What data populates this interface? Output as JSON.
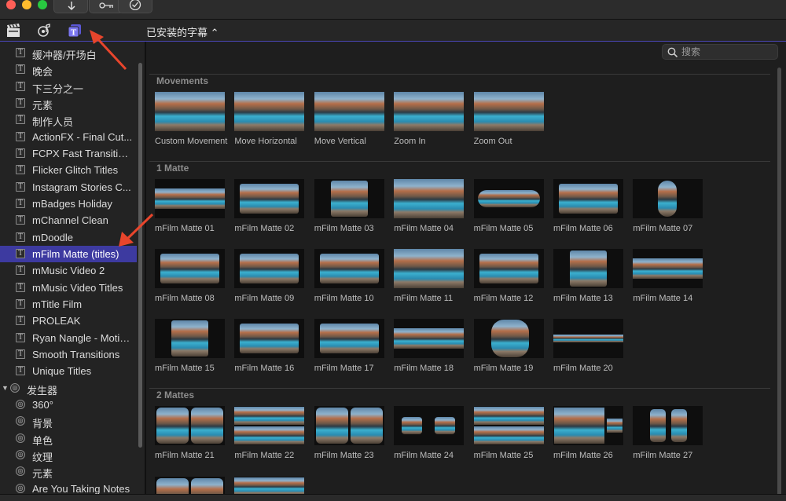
{
  "toolbar": {
    "import_icon": "down-arrow-icon",
    "keyword_icon": "key-icon",
    "check_icon": "checkmark-icon"
  },
  "browser_tabs": [
    {
      "icon": "clapper-icon",
      "selected": false
    },
    {
      "icon": "music-photo-icon",
      "selected": false
    },
    {
      "icon": "titles-generators-icon",
      "selected": true
    }
  ],
  "library_title": "已安装的字幕 ⌃",
  "search": {
    "placeholder": "搜索",
    "value": ""
  },
  "sidebar": {
    "items": [
      {
        "label": "缓冲器/开场白",
        "kind": "title"
      },
      {
        "label": "晚会",
        "kind": "title"
      },
      {
        "label": "下三分之一",
        "kind": "title"
      },
      {
        "label": "元素",
        "kind": "title"
      },
      {
        "label": "制作人员",
        "kind": "title"
      },
      {
        "label": "ActionFX - Final Cut...",
        "kind": "title"
      },
      {
        "label": "FCPX Fast Transition...",
        "kind": "title"
      },
      {
        "label": "Flicker Glitch Titles",
        "kind": "title"
      },
      {
        "label": "Instagram Stories C...",
        "kind": "title"
      },
      {
        "label": "mBadges Holiday",
        "kind": "title"
      },
      {
        "label": "mChannel Clean",
        "kind": "title"
      },
      {
        "label": "mDoodle",
        "kind": "title"
      },
      {
        "label": "mFilm Matte (titles)",
        "kind": "title",
        "selected": true
      },
      {
        "label": "mMusic Video 2",
        "kind": "title"
      },
      {
        "label": "mMusic Video Titles",
        "kind": "title"
      },
      {
        "label": "mTitle Film",
        "kind": "title"
      },
      {
        "label": "PROLEAK",
        "kind": "title"
      },
      {
        "label": "Ryan Nangle - Motio...",
        "kind": "title"
      },
      {
        "label": "Smooth Transitions",
        "kind": "title"
      },
      {
        "label": "Unique Titles",
        "kind": "title"
      },
      {
        "label": "发生器",
        "kind": "group"
      },
      {
        "label": "360°",
        "kind": "generator"
      },
      {
        "label": "背景",
        "kind": "generator"
      },
      {
        "label": "单色",
        "kind": "generator"
      },
      {
        "label": "纹理",
        "kind": "generator"
      },
      {
        "label": "元素",
        "kind": "generator"
      },
      {
        "label": "Are You Taking Notes",
        "kind": "generator"
      }
    ]
  },
  "sections": [
    {
      "heading": "Movements",
      "tiles": [
        {
          "name": "Custom Movement",
          "matte": "full"
        },
        {
          "name": "Move Horizontal",
          "matte": "full"
        },
        {
          "name": "Move Vertical",
          "matte": "full"
        },
        {
          "name": "Zoom In",
          "matte": "full"
        },
        {
          "name": "Zoom Out",
          "matte": "full"
        }
      ]
    },
    {
      "heading": "1 Matte",
      "tiles": [
        {
          "name": "mFilm Matte 01",
          "matte": "wide"
        },
        {
          "name": "mFilm Matte 02",
          "matte": "inset"
        },
        {
          "name": "mFilm Matte 03",
          "matte": "center"
        },
        {
          "name": "mFilm Matte 04",
          "matte": "full"
        },
        {
          "name": "mFilm Matte 05",
          "matte": "pill"
        },
        {
          "name": "mFilm Matte 06",
          "matte": "inset"
        },
        {
          "name": "mFilm Matte 07",
          "matte": "vpill"
        },
        {
          "name": "mFilm Matte 08",
          "matte": "inset"
        },
        {
          "name": "mFilm Matte 09",
          "matte": "inset"
        },
        {
          "name": "mFilm Matte 10",
          "matte": "inset"
        },
        {
          "name": "mFilm Matte 11",
          "matte": "full"
        },
        {
          "name": "mFilm Matte 12",
          "matte": "inset"
        },
        {
          "name": "mFilm Matte 13",
          "matte": "center"
        },
        {
          "name": "mFilm Matte 14",
          "matte": "wide"
        },
        {
          "name": "mFilm Matte 15",
          "matte": "center"
        },
        {
          "name": "mFilm Matte 16",
          "matte": "inset"
        },
        {
          "name": "mFilm Matte 17",
          "matte": "inset"
        },
        {
          "name": "mFilm Matte 18",
          "matte": "wide"
        },
        {
          "name": "mFilm Matte 19",
          "matte": "circle"
        },
        {
          "name": "mFilm Matte 20",
          "matte": "strip"
        }
      ]
    },
    {
      "heading": "2 Mattes",
      "tiles": [
        {
          "name": "mFilm Matte 21",
          "matte": "two"
        },
        {
          "name": "mFilm Matte 22",
          "matte": "stack"
        },
        {
          "name": "mFilm Matte 23",
          "matte": "two"
        },
        {
          "name": "mFilm Matte 24",
          "matte": "twosmall"
        },
        {
          "name": "mFilm Matte 25",
          "matte": "stack"
        },
        {
          "name": "mFilm Matte 26",
          "matte": "bigsmall"
        },
        {
          "name": "mFilm Matte 27",
          "matte": "twovpill"
        },
        {
          "name": "",
          "matte": "two"
        },
        {
          "name": "",
          "matte": "stack"
        }
      ]
    }
  ],
  "annotations": {
    "arrow_color": "#e8452c"
  }
}
